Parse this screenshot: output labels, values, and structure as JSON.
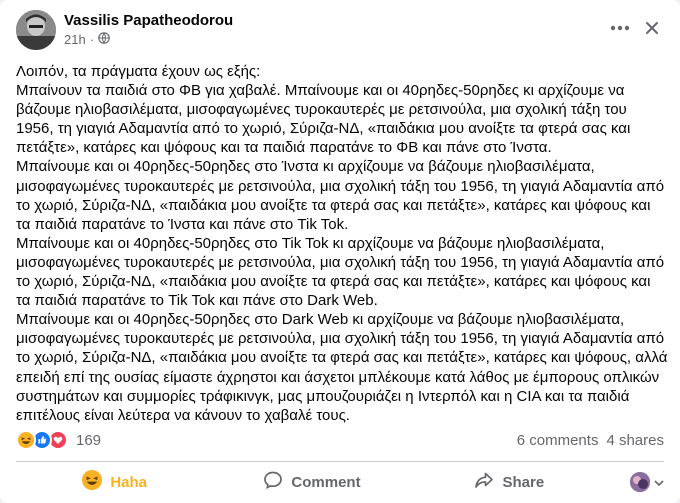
{
  "post": {
    "author": "Vassilis Papatheodorou",
    "time": "21h",
    "time_separator": "·",
    "paragraphs": [
      "Λοιπόν, τα πράγματα έχουν ως εξής:",
      "Μπαίνουν τα παιδιά στο ΦΒ για χαβαλέ. Μπαίνουμε και οι 40ρηδες-50ρηδες κι αρχίζουμε να βάζουμε ηλιοβασιλέματα, μισοφαγωμένες τυροκαυτερές με ρετσινούλα, μια σχολική τάξη του 1956, τη γιαγιά Αδαμαντία από το χωριό, Σύριζα-ΝΔ, «παιδάκια μου ανοίξτε τα φτερά σας και πετάξτε», κατάρες και ψόφους και τα παιδιά παρατάνε το ΦΒ και πάνε στο Ίνστα.",
      "Μπαίνουμε και οι 40ρηδες-50ρηδες στο Ίνστα κι αρχίζουμε να βάζουμε ηλιοβασιλέματα, μισοφαγωμένες τυροκαυτερές με ρετσινούλα, μια σχολική τάξη του 1956, τη γιαγιά Αδαμαντία από το χωριό, Σύριζα-ΝΔ, «παιδάκια μου ανοίξτε τα φτερά σας και πετάξτε», κατάρες και ψόφους και τα παιδιά παρατάνε το Ίνστα και πάνε στο Tik Tok.",
      "Μπαίνουμε και οι 40ρηδες-50ρηδες στο Tik Tok κι αρχίζουμε να βάζουμε ηλιοβασιλέματα, μισοφαγωμένες τυροκαυτερές με ρετσινούλα, μια σχολική τάξη του 1956, τη γιαγιά Αδαμαντία από το χωριό, Σύριζα-ΝΔ, «παιδάκια μου ανοίξτε τα φτερά σας και πετάξτε», κατάρες και ψόφους και τα παιδιά παρατάνε το Tik Tok και πάνε στο Dark Web.",
      "Μπαίνουμε και οι 40ρηδες-50ρηδες στο Dark Web κι αρχίζουμε να βάζουμε ηλιοβασιλέματα, μισοφαγωμένες τυροκαυτερές με ρετσινούλα, μια σχολική τάξη του 1956, τη γιαγιά Αδαμαντία από το χωριό, Σύριζα-ΝΔ, «παιδάκια μου ανοίξτε τα φτερά σας και πετάξτε», κατάρες και ψόφους, αλλά επειδή επί της ουσίας είμαστε άχρηστοι και άσχετοι μπλέκουμε κατά λάθος με έμπορους οπλικών συστημάτων και συμμορίες τράφικινγκ, μας μπουζουριάζει η Ιντερπόλ και η CIA και τα παιδιά επιτέλους είναι λεύτερα να κάνουν το χαβαλέ τους."
    ]
  },
  "stats": {
    "reaction_count": "169",
    "comments": "6 comments",
    "shares": "4 shares",
    "reaction_icons": [
      "haha-emoji-icon",
      "like-icon",
      "love-icon"
    ]
  },
  "actions": {
    "haha_label": "Haha",
    "comment_label": "Comment",
    "share_label": "Share"
  },
  "colors": {
    "haha": "#f7b125",
    "like": "#1877f2",
    "love": "#f33e58",
    "secondary_text": "#65676b"
  }
}
